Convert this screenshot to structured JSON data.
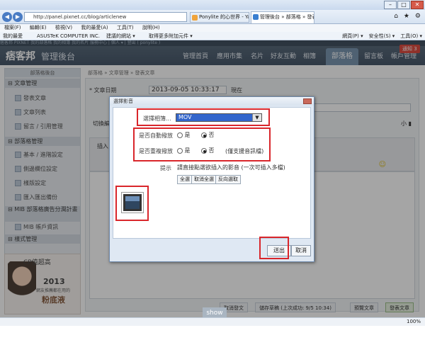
{
  "browser": {
    "url": "http://panel.pixnet.cc/blog/articlenew",
    "tabs": [
      {
        "label": "Ponylite 的心世界 - Yahoo!部..."
      },
      {
        "label": "管理後台 » 部落格 » 發表文..."
      }
    ],
    "menu": [
      "檔案(F)",
      "編輯(E)",
      "檢視(V)",
      "我的最愛(A)",
      "工具(T)",
      "說明(H)"
    ],
    "favorites": [
      "我的最愛",
      "ASUSTeK COMPUTER INC.",
      "建議的網站 ▾",
      "取得更多附加元件 ▾"
    ],
    "tools": [
      "網頁(P) ▾",
      "安全性(S) ▾",
      "工具(O) ▾"
    ],
    "status": "",
    "zoom": "100%"
  },
  "pixnet": {
    "topline": "痞客邦 PIXNET   我的部落格   我的相簿   我的名片   服務中心  |  個人 ▾  |  登出 ( ponylite )",
    "logo": "痞客邦",
    "logo_sub": "管理後台",
    "nav": [
      "管理首頁",
      "應用市集",
      "名片",
      "好友互動",
      "相簿"
    ],
    "nav_active": "部落格",
    "nav_after": [
      "留言板",
      "帳戶管理"
    ],
    "notice": "通知 3"
  },
  "sidebar": {
    "head": "部落格後台",
    "sections": [
      {
        "label": "文章管理",
        "items": [
          "發表文章",
          "文章列表",
          "留言 / 引用管理"
        ]
      },
      {
        "label": "部落格管理",
        "items": [
          "基本 / 進階設定",
          "側邊欄位設定",
          "樣版設定",
          "匯入匯出備份"
        ]
      },
      {
        "label": "MIB 部落格廣告分潤計畫",
        "items": [
          "MIB 帳戶資訊"
        ]
      },
      {
        "label": "樣式管理",
        "items": []
      }
    ]
  },
  "promo": {
    "title": "CP值超高",
    "year": "2013",
    "line1": "網友推薦都在用的",
    "line2": "粉底液"
  },
  "editor": {
    "breadcrumb": "部落格  »  文章管理  »  發表文章",
    "date_label": "* 文章日期",
    "date_value": "2013-09-05 10:33:17",
    "now_label": "現在",
    "toolbar_left": "切換編",
    "toolbar_insert": "插入",
    "toolbar_size": "小 ▮",
    "show": "show"
  },
  "bottom": {
    "cancel": "取消發文",
    "save_draft": "儲存草稿 (上次成功: 9/5 10:34)",
    "preview": "預覽文章",
    "publish": "發表文章"
  },
  "dialog": {
    "title": "選擇影音",
    "category_label": "選擇相簿...",
    "category_value": "MOV",
    "autoplay_label": "是否自動撥放",
    "loop_label": "是否重複撥放",
    "yes": "是",
    "no": "否",
    "loop_note": "(僅支援音訊檔)",
    "hint_label": "提示",
    "hint_text": "請直接點選欲插入的影音 (一次可插入多檔)",
    "select_all": "全選",
    "deselect_all": "取消全選",
    "invert": "反向選取",
    "submit": "送出",
    "cancel": "取消"
  }
}
